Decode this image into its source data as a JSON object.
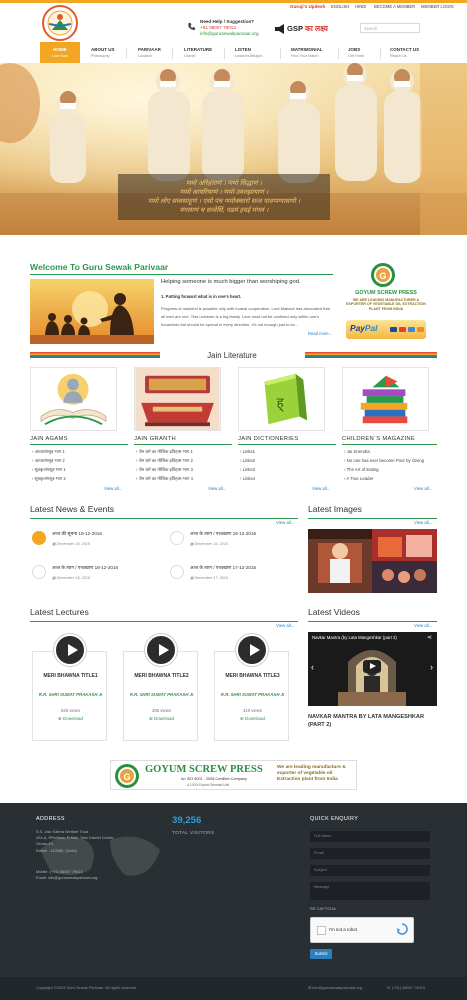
{
  "header": {
    "update_label": "Guruji's Updesh",
    "top_links": [
      "ENGLISH",
      "HINDI",
      "BECOME A MEMBER",
      "MEMBER LOGIN"
    ],
    "help_title": "Need Help / Suggestion?",
    "phone": "+91 08007 79013",
    "email": "info@gurusewakparivaar.org",
    "gsp_text": "GSP",
    "gsp_hindi": "का लक्ष्य",
    "search_placeholder": "Search"
  },
  "nav": [
    {
      "label": "HOME",
      "sub": "Live Now"
    },
    {
      "label": "ABOUT US",
      "sub": "Philosophy"
    },
    {
      "label": "PARIVAAR",
      "sub": "Location"
    },
    {
      "label": "LITERATURE",
      "sub": "Granth"
    },
    {
      "label": "LISTEN",
      "sub": "Lectures/Bhajan"
    },
    {
      "label": "MATRIMONIAL",
      "sub": "Find Your Match"
    },
    {
      "label": "JOBS",
      "sub": "Get Hired"
    },
    {
      "label": "CONTACT US",
      "sub": "Reach Us"
    }
  ],
  "hero": {
    "mantra": [
      "णमो अरिहंताणं । णमो सिद्धाणं ।",
      "णमो आयरियाणं । णमो उवज्झायाणं ।",
      "णमो लोए सव्वसाहूणं । एसो पंच णमोक्कारो सव्व पावप्पणासणो ।",
      "मंगलाणं च सव्वेसिं, पढमं हवई मंगलं ।"
    ]
  },
  "welcome": {
    "title": "Welcome To Guru Sewak Parivaar",
    "tagline": "Helping someone is much bigger than worshiping god.",
    "point": "1. Putting forward what is in one's heart.",
    "body": "Progress of mankind is possible only with mutual cooperation. Lord Mahavir has advocated that all men are one. This universe is a big family. Love must not be confined only within one's household but should be spread in every direction. It's not enough just to ke...",
    "read_more": "Read more..."
  },
  "sponsor": {
    "name": "GOYUM SCREW PRESS",
    "desc": "WE ARE LEADING MANUFACTURER & EXPORTER OF VEGETABLE OIL EXTRACTION PLANT FROM INDIA",
    "paypal_a": "Pay",
    "paypal_b": "Pal"
  },
  "literature": {
    "title": "Jain Literature",
    "columns": [
      {
        "title": "JAIN AGAMS",
        "items": [
          "आचारांगसूत्र भाग 1",
          "आचारांगसूत्र भाग 2",
          "सूत्रकृतांगसूत्र भाग 1",
          "सूत्रकृतांगसूत्र भाग 2"
        ],
        "view_all": "View all..."
      },
      {
        "title": "JAIN GRANTH",
        "items": [
          "जैन धर्म का मौलिक इतिहास भाग 1",
          "जैन धर्म का मौलिक इतिहास भाग 2",
          "जैन धर्म का मौलिक इतिहास भाग 3",
          "जैन धर्म का मौलिक इतिहास भाग 4"
        ],
        "view_all": "View all..."
      },
      {
        "title": "JAIN DICTIONERIES",
        "items": [
          "Links1",
          "Links2",
          "Links3",
          "Links4"
        ],
        "view_all": "View all..."
      },
      {
        "title": "CHILDREN`S MAGAZINE",
        "items": [
          "Jai Jinendra",
          "No one has ever become Poor by Giving",
          "The Art of Eating",
          "A True Leader"
        ],
        "view_all": "View all..."
      }
    ]
  },
  "news": {
    "title": "Latest News & Events",
    "view_all": "View all...",
    "items": [
      {
        "title": "आज की सूचना 19-12-2016",
        "date": "December 19, 2016"
      },
      {
        "title": "आज के त्याग / पच्चखाण 19-12-2016",
        "date": "December 19, 2016"
      },
      {
        "title": "आज के त्याग / पच्चखाण 18-12-2016",
        "date": "December 18, 2016"
      },
      {
        "title": "आज के त्याग / पच्चखाण 17-12-2016",
        "date": "December 17, 2016"
      }
    ]
  },
  "images": {
    "title": "Latest Images",
    "view_all": "View all..."
  },
  "lectures": {
    "title": "Latest Lectures",
    "view_all": "View all...",
    "items": [
      {
        "title": "MERI BHAWNA TITLE1",
        "speaker": "R.R. SHRI SUMAT PRAKASH JI",
        "views": "625 views",
        "download": "Download"
      },
      {
        "title": "MERI BHAWNA TITLE2",
        "speaker": "R.R. SHRI SUMAT PRAKASH JI",
        "views": "395 views",
        "download": "Download"
      },
      {
        "title": "MERI BHAWNA TITLE3",
        "speaker": "R.R. SHRI SUMAT PRAKASH JI",
        "views": "310 views",
        "download": "Download"
      }
    ]
  },
  "videos": {
    "title": "Latest Videos",
    "view_all": "View all...",
    "video_title": "Navkar Mantra (by Lata Mangeshkar (part 2)",
    "caption": "NAVKAR MANTRA BY LATA MANGESHKAR (PART 2)"
  },
  "banner": {
    "name": "GOYUM SCREW PRESS",
    "cert": "An ISO 9001 : 2008 Certified Company",
    "cert2": "A 100% Export Oriented Unit",
    "right": "We are leading manufacture & exporter of vegetable oil Extraction plant from India"
  },
  "footer": {
    "address_title": "ADDRESS",
    "address": [
      "S.S. Jain Sabha Welfare Trust",
      "424-A, RRoNear, D Mall, Twin District Center,",
      "Sector-10,",
      "Rohini - 110085, (Delhi)"
    ],
    "mobile": "Mobile: (+91) 08007 79013",
    "email": "Email: info@gurusewakparivaar.org",
    "visitors": "39,256",
    "visitors_label": "TOTAL VISITORS",
    "enquiry_title": "QUICK ENQUIRY",
    "fields": [
      "Full Name",
      "Email",
      "Subject",
      "Message"
    ],
    "captcha_label": "RE CAPTCHA",
    "captcha_text": "I'm not a robot",
    "submit": "Submit",
    "copyright": "Copyright ©2015 Guru Sewak Parivaar. All rights reserved",
    "bottom_email": "info@gurusewakparivaar.org",
    "bottom_phone": "(+91) 08007 79013"
  }
}
